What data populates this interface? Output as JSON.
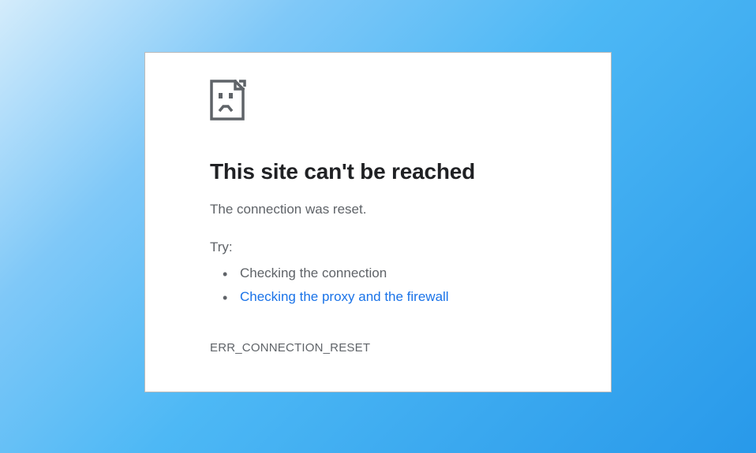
{
  "error": {
    "title": "This site can't be reached",
    "message": "The connection was reset.",
    "try_label": "Try:",
    "suggestions": {
      "check_connection": "Checking the connection",
      "check_proxy": "Checking the proxy and the firewall"
    },
    "code": "ERR_CONNECTION_RESET"
  }
}
